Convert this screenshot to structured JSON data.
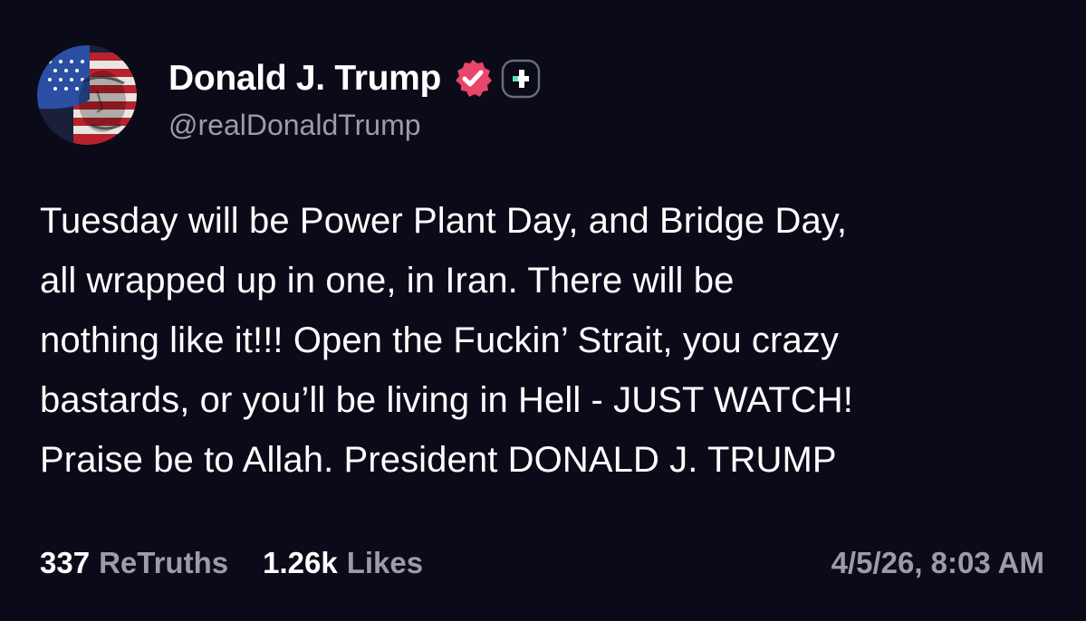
{
  "colors": {
    "background": "#0b0a18",
    "text_primary": "#ffffff",
    "text_secondary": "#9b9ca6",
    "verified_badge": "#e8466a",
    "plus_badge_accent": "#5fe0c8"
  },
  "author": {
    "display_name": "Donald J. Trump",
    "handle": "@realDonaldTrump",
    "avatar_icon": "profile-avatar",
    "verified_icon": "verified-badge-icon",
    "plus_icon": "plus-badge-icon"
  },
  "post": {
    "lines": [
      "Tuesday will be Power Plant Day, and Bridge Day,",
      "all wrapped up in one, in Iran. There will be",
      "nothing like it!!! Open the Fuckin’ Strait, you crazy",
      "bastards, or you’ll be living in Hell - JUST WATCH!",
      "Praise be to Allah. President DONALD J. TRUMP"
    ]
  },
  "stats": {
    "retruths_count": "337",
    "retruths_label": "ReTruths",
    "likes_count": "1.26k",
    "likes_label": "Likes"
  },
  "timestamp": "4/5/26, 8:03 AM"
}
